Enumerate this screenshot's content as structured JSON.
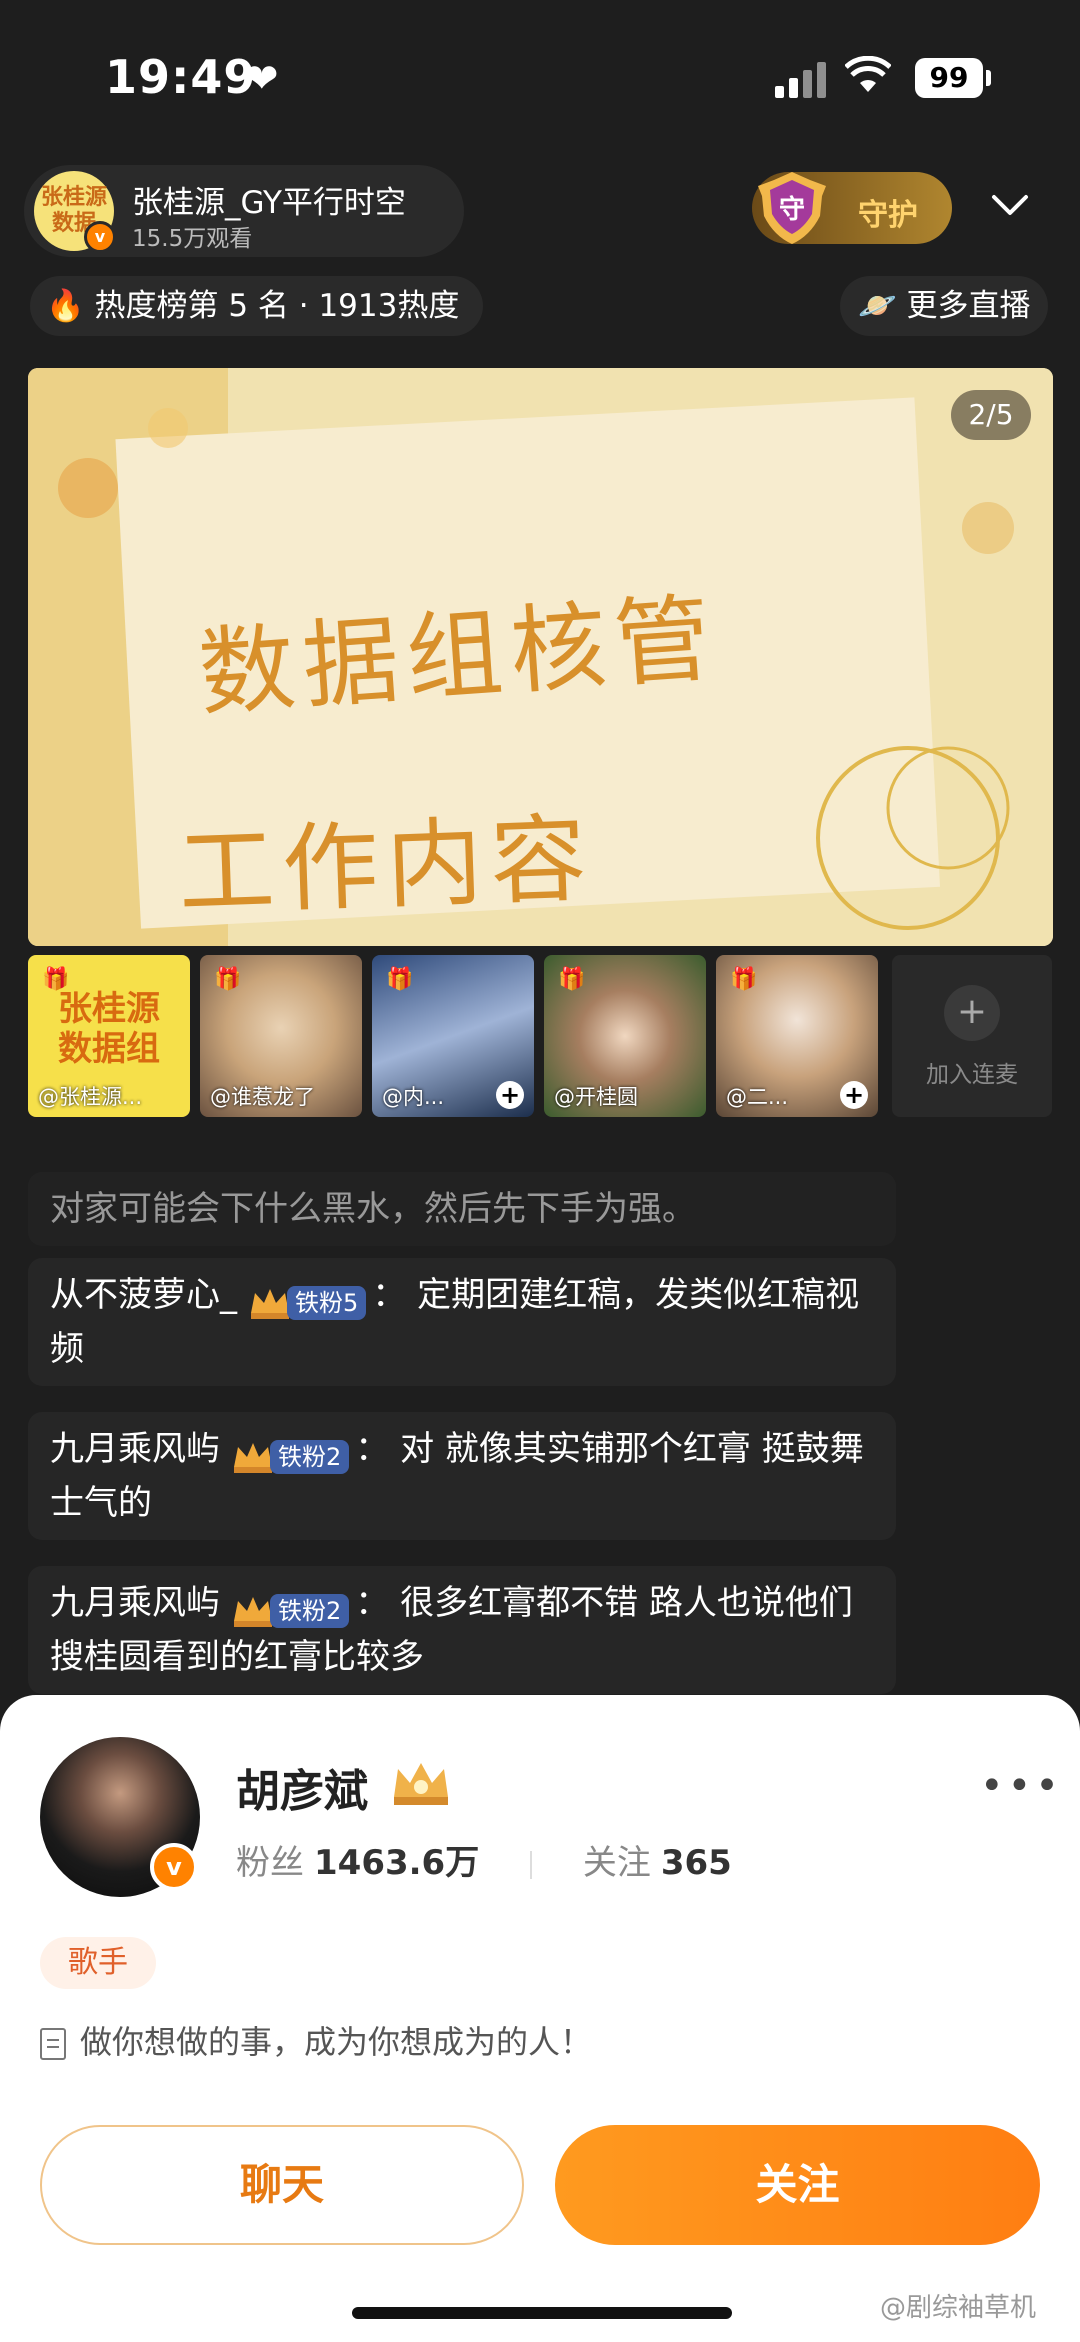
{
  "status": {
    "time": "19:49",
    "battery": "99"
  },
  "host": {
    "avatar_text": "张桂源\n数据",
    "name": "张桂源_GY平行时空",
    "views": "15.5万观看"
  },
  "guard": {
    "icon_text": "守",
    "label": "守护"
  },
  "rank": {
    "text": "热度榜第 5 名 · 1913热度"
  },
  "more_live": {
    "text": "更多直播"
  },
  "stream": {
    "page_indicator": "2/5",
    "title_line1": "数据组核管",
    "title_line2": "工作内容"
  },
  "guests": [
    {
      "name": "@张桂源...",
      "avatar_text": "张桂源\n数据组"
    },
    {
      "name": "@谁惹龙了"
    },
    {
      "name": "@内..."
    },
    {
      "name": "@开桂圆"
    },
    {
      "name": "@二..."
    }
  ],
  "add_seat": {
    "label": "加入连麦"
  },
  "chat": {
    "faded": "对家可能会下什么黑水，然后先下手为强。",
    "messages": [
      {
        "user": "从不菠萝心_",
        "level": "铁粉5",
        "text": "定期团建红稿，发类似红稿视频"
      },
      {
        "user": "九月乘风屿",
        "level": "铁粉2",
        "text": "对 就像其实铺那个红膏 挺鼓舞士气的"
      },
      {
        "user": "九月乘风屿",
        "level": "铁粉2",
        "text": "很多红膏都不错 路人也说他们搜桂圆看到的红膏比较多"
      }
    ]
  },
  "profile": {
    "name": "胡彦斌",
    "fans_label": "粉丝",
    "fans_value": "1463.6万",
    "follow_label": "关注",
    "follow_value": "365",
    "tag": "歌手",
    "bio": "做你想做的事，成为你想成为的人！",
    "chat_button": "聊天",
    "follow_button": "关注"
  },
  "watermark": "@剧综袖草机"
}
